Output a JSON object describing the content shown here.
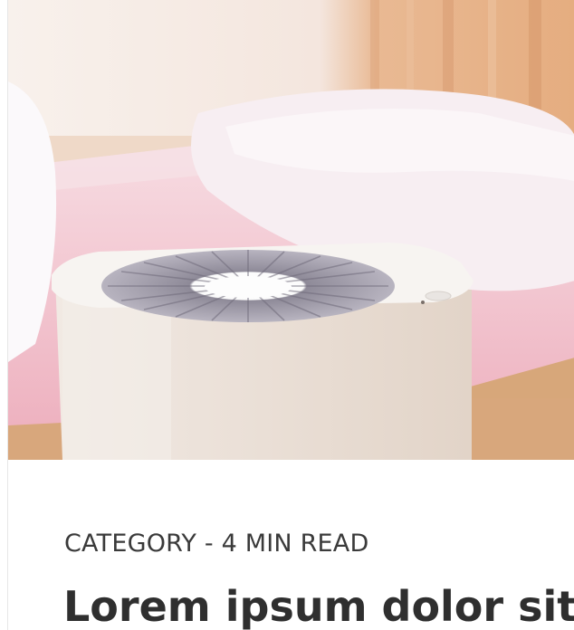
{
  "article_card": {
    "image": {
      "icon": "air-purifier-photo",
      "colors": {
        "wall": "#f3ece6",
        "curtain": "#e8b48c",
        "bed_frame": "#d9ab7f",
        "blanket": "#efb9c4",
        "pillow": "#f4e9ee",
        "purifier_body": "#ece4dc",
        "purifier_top": "#f6f2ee"
      }
    },
    "category_line": "CATEGORY - 4 MIN READ",
    "title": "Lorem ipsum dolor sit a"
  }
}
